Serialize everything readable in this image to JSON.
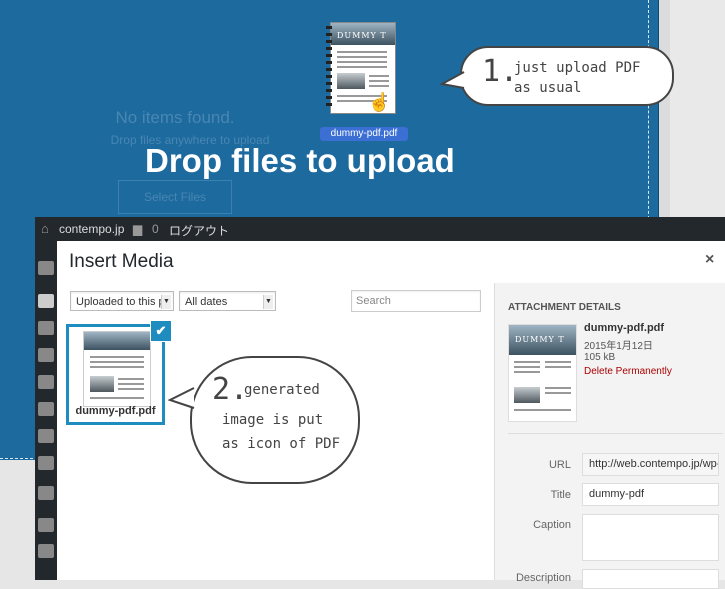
{
  "drop_overlay": {
    "no_items": "No items found.",
    "drop_anywhere": "Drop files anywhere to upload",
    "select_files": "Select Files",
    "headline": "Drop files to upload",
    "dragged_file": "dummy-pdf.pdf",
    "pdf_banner_text": "DUMMY T"
  },
  "callout1": {
    "number": "1.",
    "line1": "just upload PDF",
    "line2": "as usual"
  },
  "callout2": {
    "number": "2.",
    "line1": "generated",
    "line2": "image is put",
    "line3": "as icon of PDF"
  },
  "adminbar": {
    "site": "contempo.jp",
    "comments": "0",
    "logout": "ログアウト"
  },
  "modal": {
    "title": "Insert Media",
    "close": "×",
    "filter_type": "Uploaded to this po",
    "filter_date": "All dates",
    "search_placeholder": "Search",
    "thumb_filename": "dummy-pdf.pdf"
  },
  "details": {
    "heading": "ATTACHMENT DETAILS",
    "filename": "dummy-pdf.pdf",
    "date": "2015年1月12日",
    "size": "105 kB",
    "delete": "Delete Permanently",
    "thumb_banner": "DUMMY T",
    "url_label": "URL",
    "url_value": "http://web.contempo.jp/wp-",
    "title_label": "Title",
    "title_value": "dummy-pdf",
    "caption_label": "Caption",
    "description_label": "Description"
  },
  "colors": {
    "overlay": "#1c6a9e",
    "accent": "#1e8cbe",
    "delete": "#a00",
    "adminbar": "#23282d"
  }
}
